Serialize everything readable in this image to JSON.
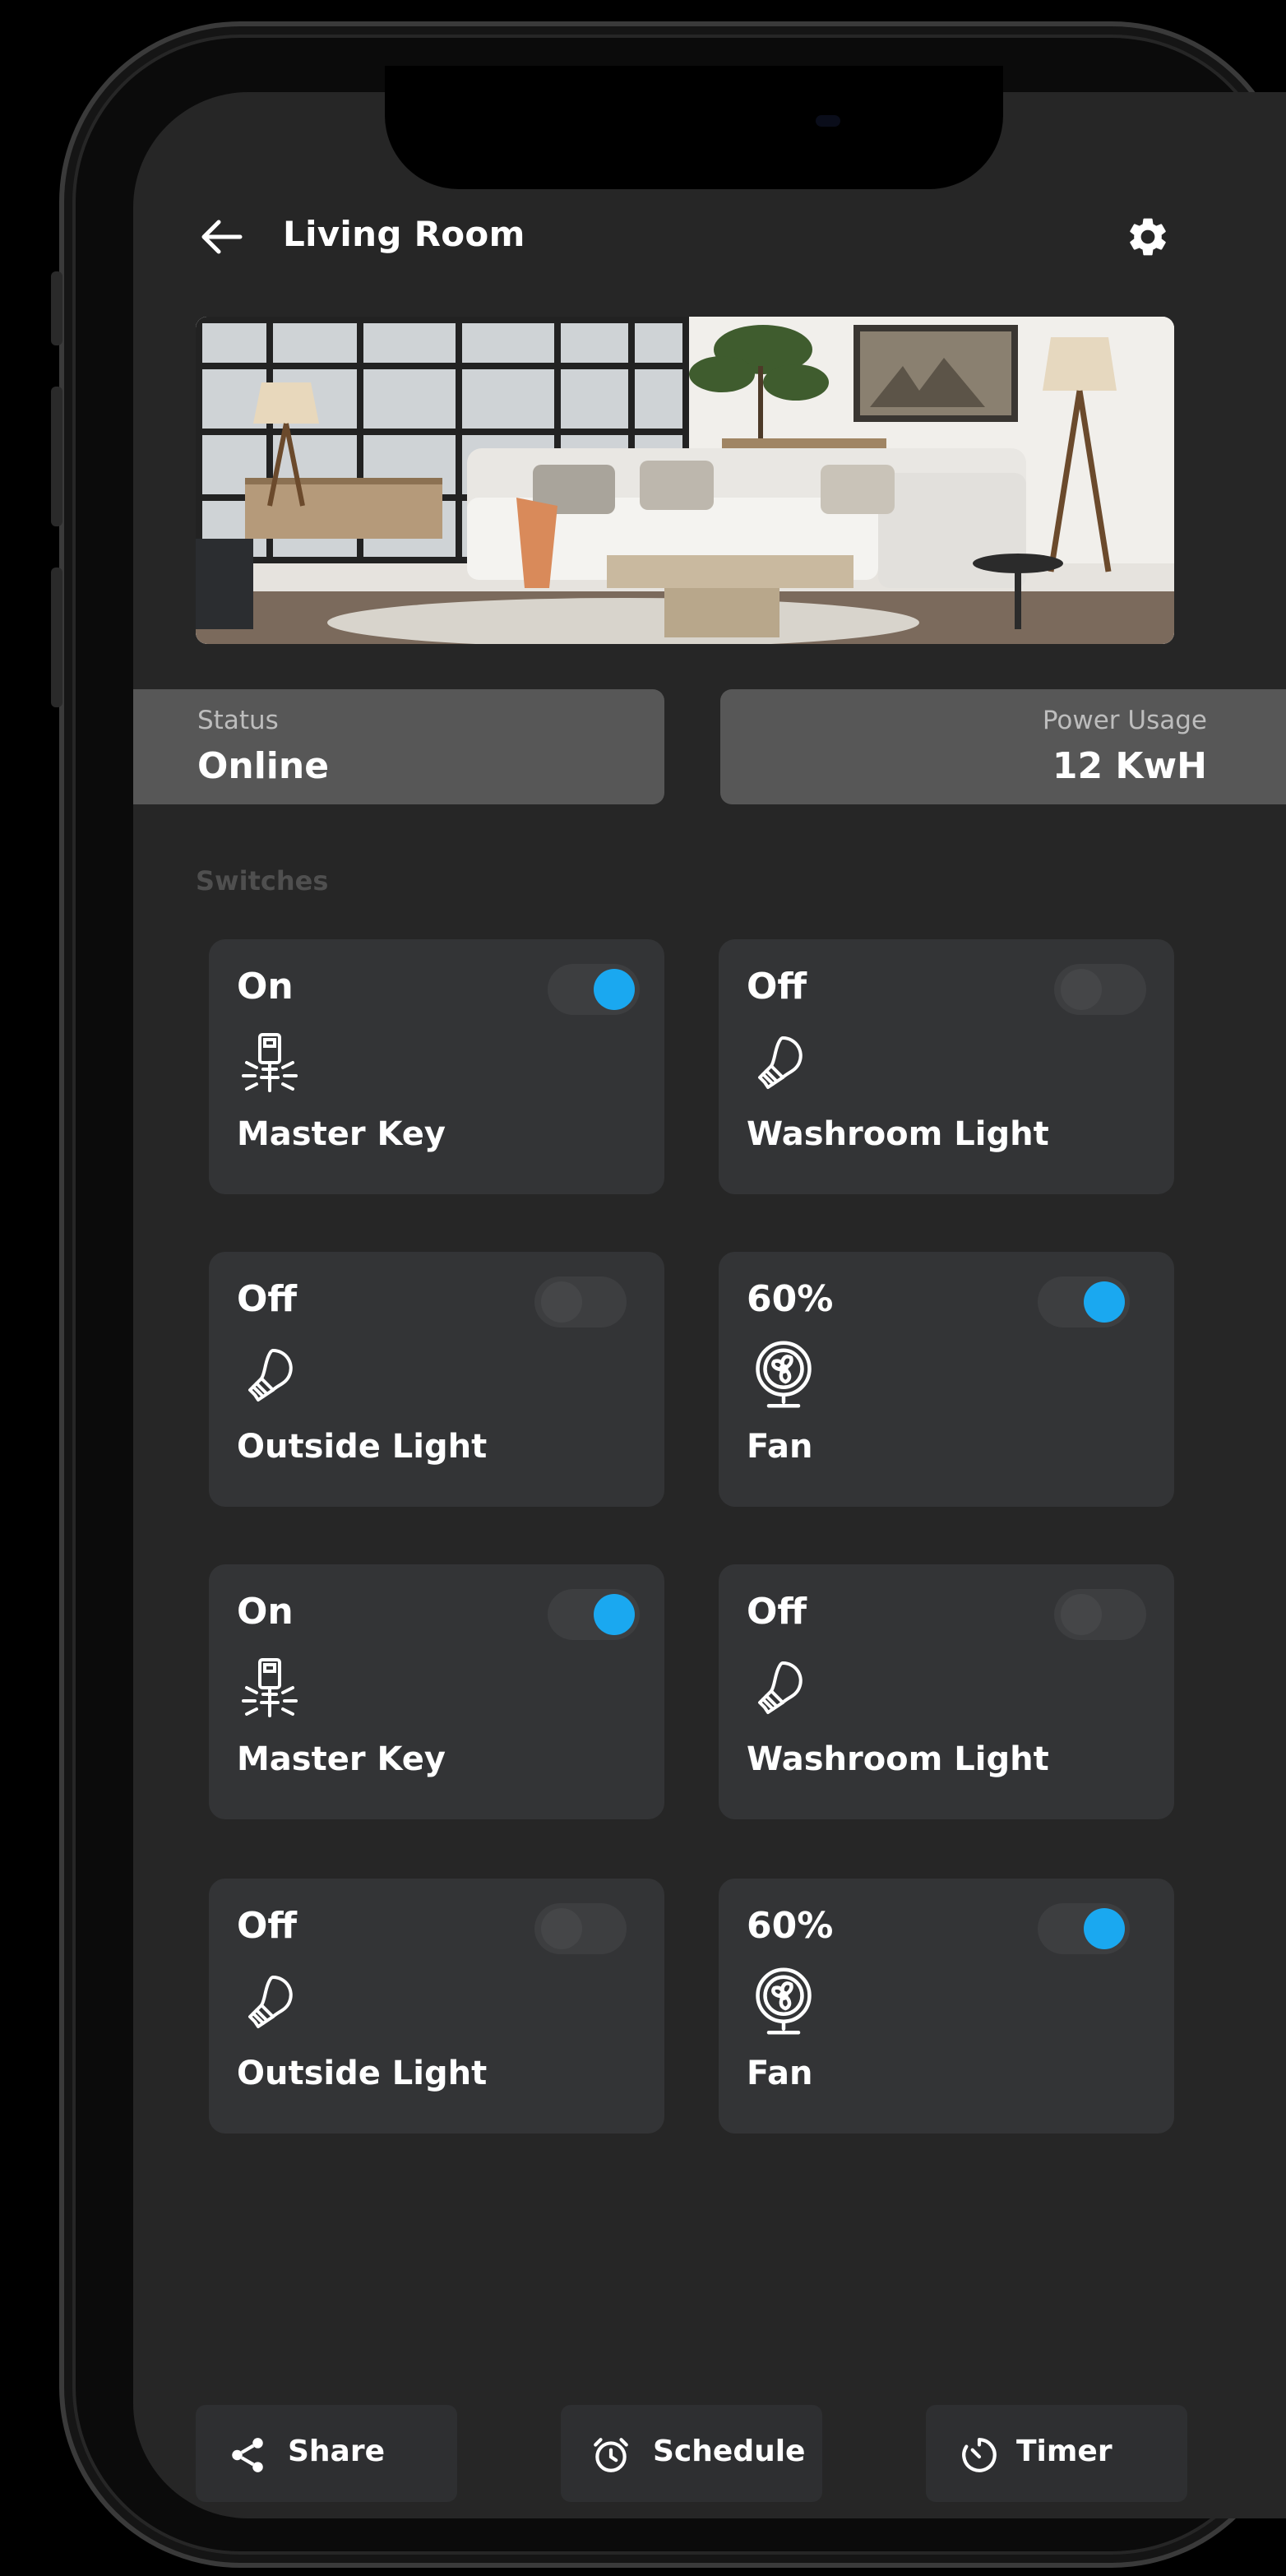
{
  "header": {
    "title": "Living Room"
  },
  "status_panel": {
    "label": "Status",
    "value": "Online"
  },
  "power_panel": {
    "label": "Power Usage",
    "value": "12 KwH"
  },
  "switches_section": {
    "label": "Switches"
  },
  "switches": [
    {
      "state": "On",
      "name": "Master Key",
      "icon": "remote-icon",
      "toggle": true
    },
    {
      "state": "Off",
      "name": "Washroom Light",
      "icon": "bulb-icon",
      "toggle": false
    },
    {
      "state": "Off",
      "name": "Outside Light",
      "icon": "bulb-icon",
      "toggle": false
    },
    {
      "state": "60%",
      "name": "Fan",
      "icon": "fan-icon",
      "toggle": true
    },
    {
      "state": "On",
      "name": "Master Key",
      "icon": "remote-icon",
      "toggle": true
    },
    {
      "state": "Off",
      "name": "Washroom Light",
      "icon": "bulb-icon",
      "toggle": false
    },
    {
      "state": "Off",
      "name": "Outside Light",
      "icon": "bulb-icon",
      "toggle": false
    },
    {
      "state": "60%",
      "name": "Fan",
      "icon": "fan-icon",
      "toggle": true
    }
  ],
  "actions": [
    {
      "label": "Share",
      "icon": "share-icon"
    },
    {
      "label": "Schedule",
      "icon": "alarm-clock-icon"
    },
    {
      "label": "Timer",
      "icon": "timer-icon"
    }
  ],
  "colors": {
    "accent": "#1aa8f0",
    "screen_bg": "#262626",
    "card_bg": "#333436",
    "panel_bg": "#575757"
  }
}
